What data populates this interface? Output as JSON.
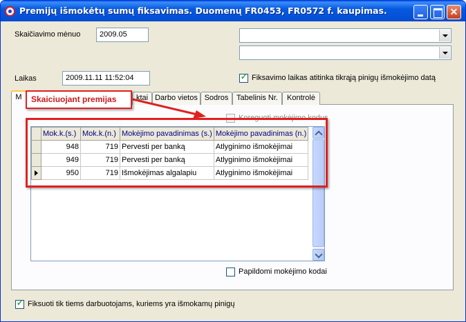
{
  "window": {
    "title": "Premijų išmokėtų sumų fiksavimas. Duomenų FR0453, FR0572 f. kaupimas.",
    "buttons": {
      "minimize": "",
      "maximize": "",
      "close": "✕"
    }
  },
  "form": {
    "month_label": "Skaičiavimo mėnuo",
    "month_value": "2009.05",
    "combo1_value": "",
    "combo2_value": "",
    "time_label": "Laikas",
    "time_value": "2009.11.11 11:52:04",
    "fix_time_checkbox_label": "Fiksavimo laikas atitinka tikrąją pinigų išmokėjimo datą",
    "fix_time_checked": true,
    "bottom_checkbox_label": "Fiksuoti tik tiems darbuotojams, kuriems yra išmokamų pinigų",
    "bottom_checked": false
  },
  "tabs": [
    {
      "label": "M",
      "active": true
    },
    {
      "label": "ktai",
      "active": false
    },
    {
      "label": "Darbo vietos",
      "active": false
    },
    {
      "label": "Sodros",
      "active": false
    },
    {
      "label": "Tabelinis Nr.",
      "active": false
    },
    {
      "label": "Kontrolė",
      "active": false
    }
  ],
  "panel": {
    "corrected_codes_label": "Koreguoti mokėjimo kodus",
    "corrected_codes_checked": false,
    "additional_codes_label": "Papildomi mokėjimo kodai",
    "additional_codes_checked": false
  },
  "grid": {
    "columns": [
      "Mok.k.(s.)",
      "Mok.k.(n.)",
      "Mokėjimo pavadinimas (s.)",
      "Mokėjimo pavadinimas (n.)"
    ],
    "rows": [
      {
        "code_s": "948",
        "code_n": "719",
        "name_s": "Pervesti per banką",
        "name_n": "Atlyginimo išmokėjimai",
        "current": false
      },
      {
        "code_s": "949",
        "code_n": "719",
        "name_s": "Pervesti per banką",
        "name_n": "Atlyginimo išmokėjimai",
        "current": false
      },
      {
        "code_s": "950",
        "code_n": "719",
        "name_s": "Išmokėjimas algalapiu",
        "name_n": "Atlyginimo išmokėjimai",
        "current": true
      }
    ]
  },
  "annotation": {
    "callout_text": "Skaiciuojant premijas",
    "color": "#e02020"
  }
}
